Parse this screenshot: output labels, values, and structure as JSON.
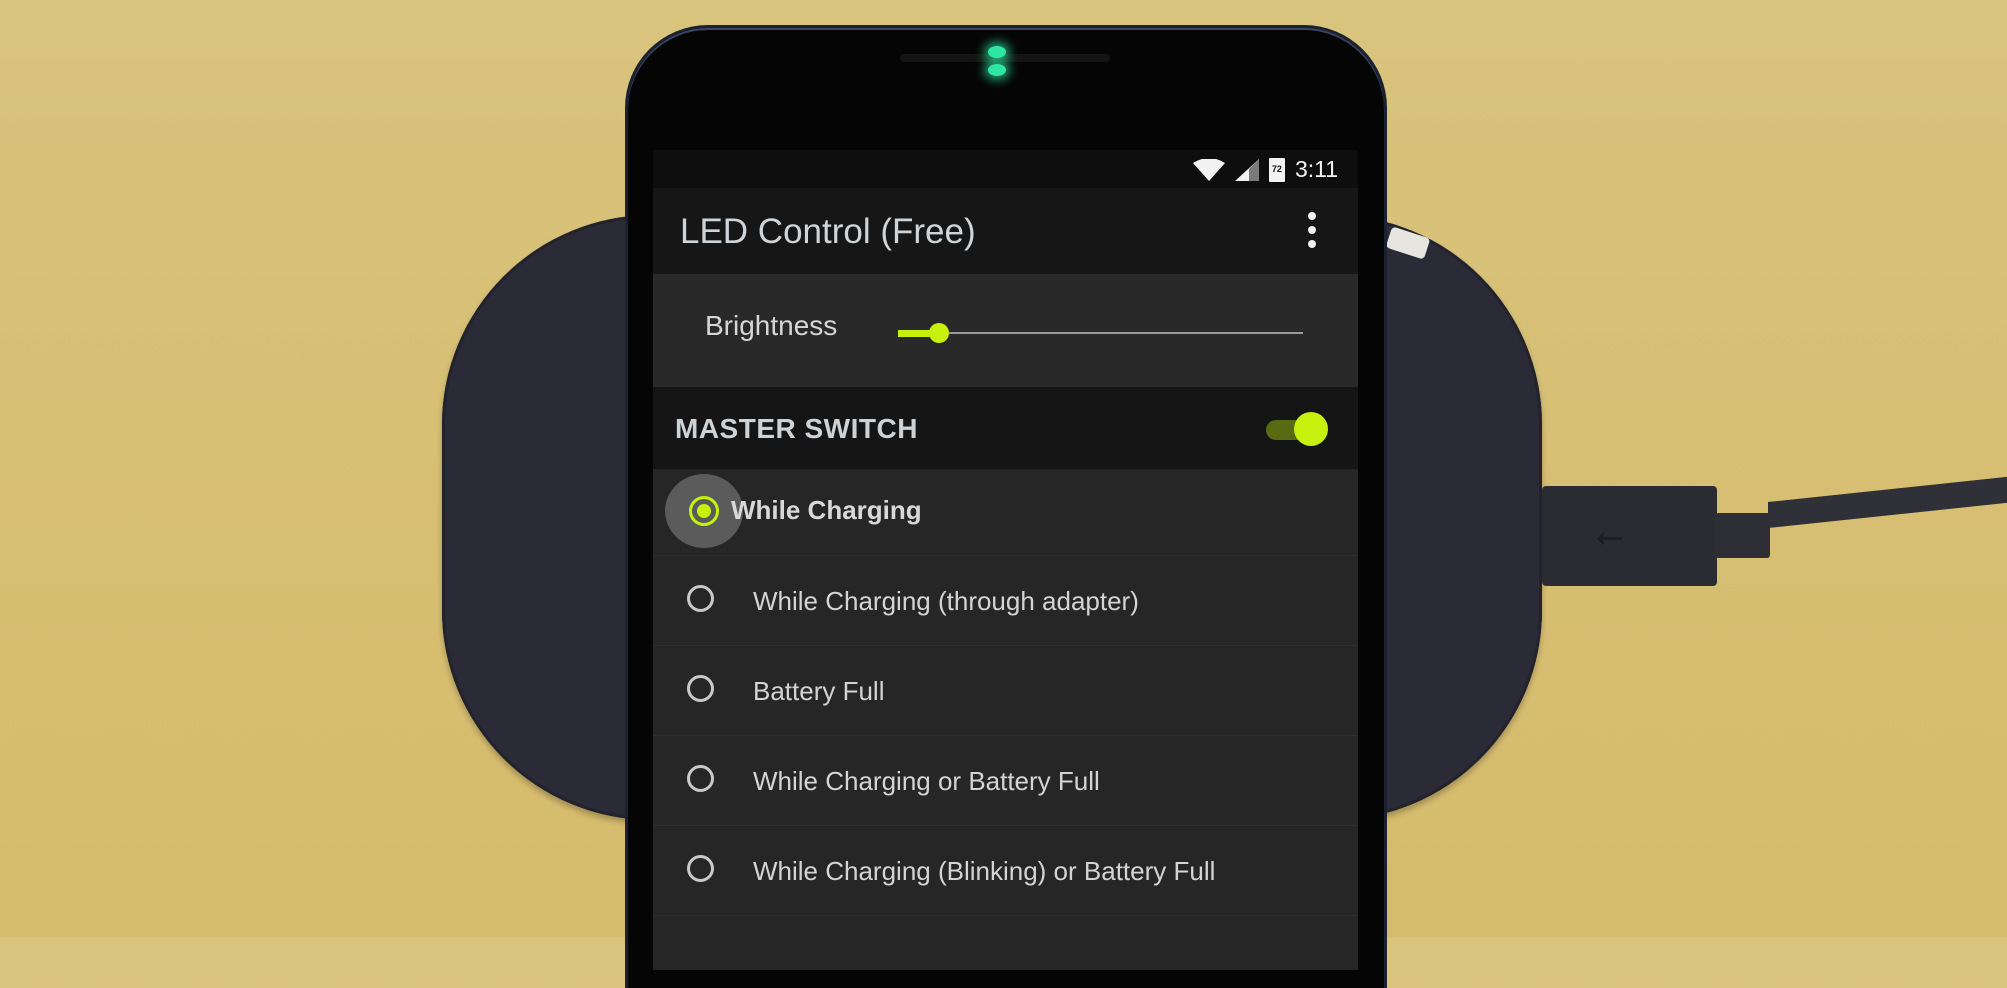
{
  "statusbar": {
    "icons": [
      "wifi-icon",
      "cell-signal-icon",
      "battery-charging-icon"
    ],
    "battery_level": "72",
    "time": "3:11"
  },
  "app": {
    "title": "LED Control (Free)",
    "overflow_icon": "more-vert-icon"
  },
  "brightness": {
    "label": "Brightness",
    "value_fraction": 0.1
  },
  "master_switch": {
    "label": "MASTER SWITCH",
    "enabled": true
  },
  "options": [
    {
      "label": "While Charging",
      "selected": true
    },
    {
      "label": "While Charging (through adapter)",
      "selected": false
    },
    {
      "label": "Battery Full",
      "selected": false
    },
    {
      "label": "While Charging or Battery Full",
      "selected": false
    },
    {
      "label": "While Charging (Blinking) or Battery Full",
      "selected": false
    }
  ],
  "colors": {
    "accent": "#c8f00f",
    "notification_led": "#2fe6a5",
    "background": "#d7bf74"
  }
}
